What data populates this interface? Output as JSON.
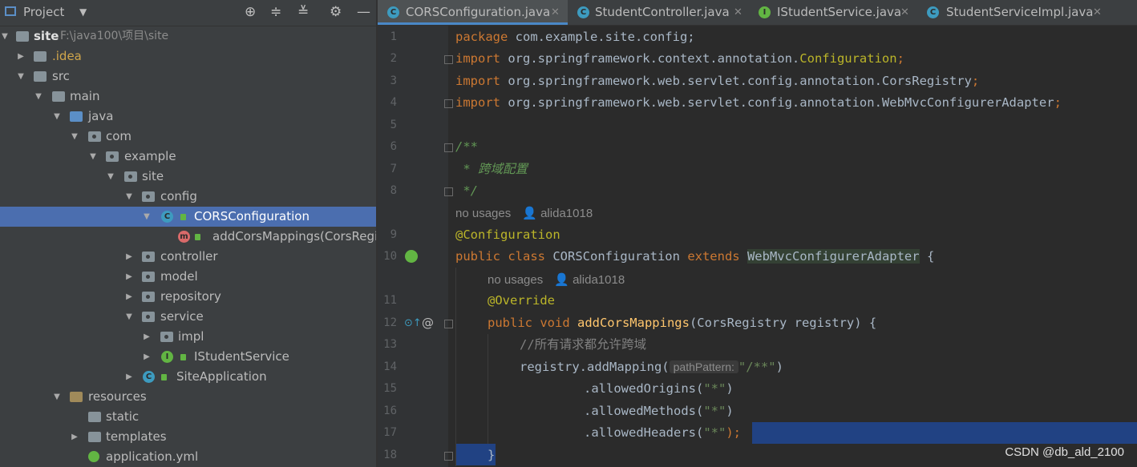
{
  "project_panel": {
    "title": "Project",
    "toolbar": [
      "locate-icon",
      "expand-all-icon",
      "collapse-all-icon",
      "gear-icon",
      "minimize-icon"
    ],
    "tree": [
      {
        "label": "site",
        "extra": "F:\\java100\\项目\\site",
        "bold": true
      },
      {
        "label": ".idea",
        "color": "#d0a64b"
      },
      {
        "label": "src"
      },
      {
        "label": "main"
      },
      {
        "label": "java"
      },
      {
        "label": "com"
      },
      {
        "label": "example"
      },
      {
        "label": "site"
      },
      {
        "label": "config"
      },
      {
        "label": "CORSConfiguration"
      },
      {
        "label": "addCorsMappings(CorsRegi"
      },
      {
        "label": "controller"
      },
      {
        "label": "model"
      },
      {
        "label": "repository"
      },
      {
        "label": "service"
      },
      {
        "label": "impl"
      },
      {
        "label": "IStudentService"
      },
      {
        "label": "SiteApplication"
      },
      {
        "label": "resources"
      },
      {
        "label": "static"
      },
      {
        "label": "templates"
      },
      {
        "label": "application.yml"
      }
    ]
  },
  "tabs": [
    {
      "label": "CORSConfiguration.java",
      "icon": "C",
      "active": true
    },
    {
      "label": "StudentController.java",
      "icon": "C"
    },
    {
      "label": "IStudentService.java",
      "icon": "I"
    },
    {
      "label": "StudentServiceImpl.java",
      "icon": "C"
    }
  ],
  "editor": {
    "line_numbers": [
      "1",
      "2",
      "3",
      "4",
      "5",
      "6",
      "7",
      "8",
      "9",
      "10",
      "11",
      "12",
      "13",
      "14",
      "15",
      "16",
      "17",
      "18"
    ],
    "hint_no_usages": "no usages",
    "hint_author": "alida1018",
    "param_hint": "pathPattern:",
    "lines": {
      "l1a": "package ",
      "l1b": "com.example.site.config;",
      "l2a": "import ",
      "l2b": "org.springframework.context.annotation.",
      "l2c": "Configuration",
      "l2d": ";",
      "l3a": "import ",
      "l3b": "org.springframework.web.servlet.config.annotation.CorsRegistry",
      "l3c": ";",
      "l4a": "import ",
      "l4b": "org.springframework.web.servlet.config.annotation.WebMvcConfigurerAdapter",
      "l4c": ";",
      "l6": "/**",
      "l7": " * 跨域配置",
      "l8": " */",
      "l9": "@Configuration",
      "l10a": "public class ",
      "l10b": "CORSConfiguration ",
      "l10c": "extends ",
      "l10d": "WebMvcConfigurerAdapter",
      "l10e": " {",
      "l11": "@Override",
      "l12a": "public void ",
      "l12b": "addCorsMappings",
      "l12c": "(CorsRegistry registry) {",
      "l13": "//所有请求都允许跨域",
      "l14a": "registry.addMapping(",
      "l14b": "\"/**\"",
      "l14c": ")",
      "l15a": ".allowedOrigins(",
      "l15b": "\"*\"",
      "l15c": ")",
      "l16a": ".allowedMethods(",
      "l16b": "\"*\"",
      "l16c": ")",
      "l17a": ".allowedHeaders(",
      "l17b": "\"*\"",
      "l17c": ");",
      "l18": "}"
    }
  },
  "watermark": "CSDN @db_ald_2100"
}
